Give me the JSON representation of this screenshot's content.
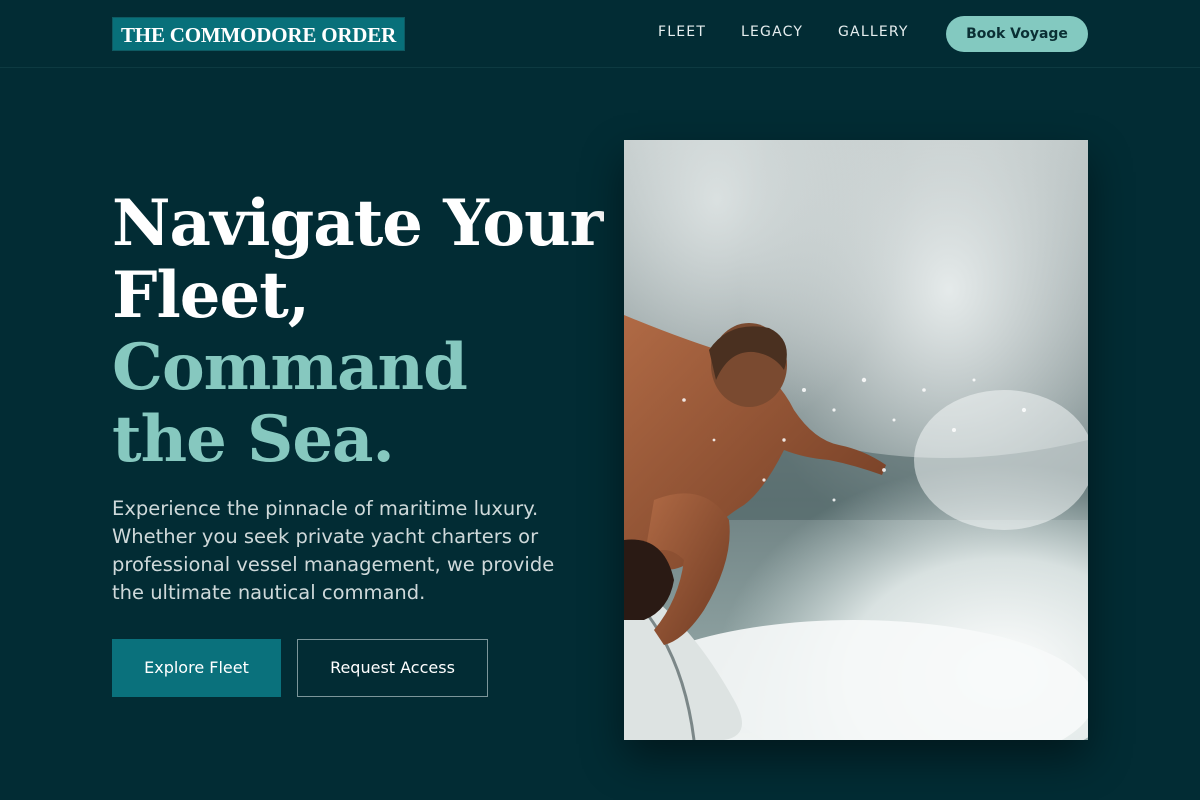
{
  "header": {
    "logo": "THE COMMODORE ORDER",
    "nav": [
      {
        "label": "FLEET"
      },
      {
        "label": "LEGACY"
      },
      {
        "label": "GALLERY"
      }
    ],
    "cta": "Book Voyage"
  },
  "hero": {
    "headline": {
      "line1": "Navigate Your",
      "line2": "Fleet,",
      "line3": "Command",
      "line4": "the Sea."
    },
    "description": "Experience the pinnacle of maritime luxury. Whether you seek private yacht charters or professional vessel management, we provide the ultimate nautical command.",
    "primary_button": "Explore Fleet",
    "secondary_button": "Request Access",
    "image": {
      "subject": "surfer riding a breaking wave"
    }
  },
  "colors": {
    "background": "#022c34",
    "accent": "#86c8bf",
    "primary_button": "#0a717c",
    "logo_bg": "#08707a"
  }
}
